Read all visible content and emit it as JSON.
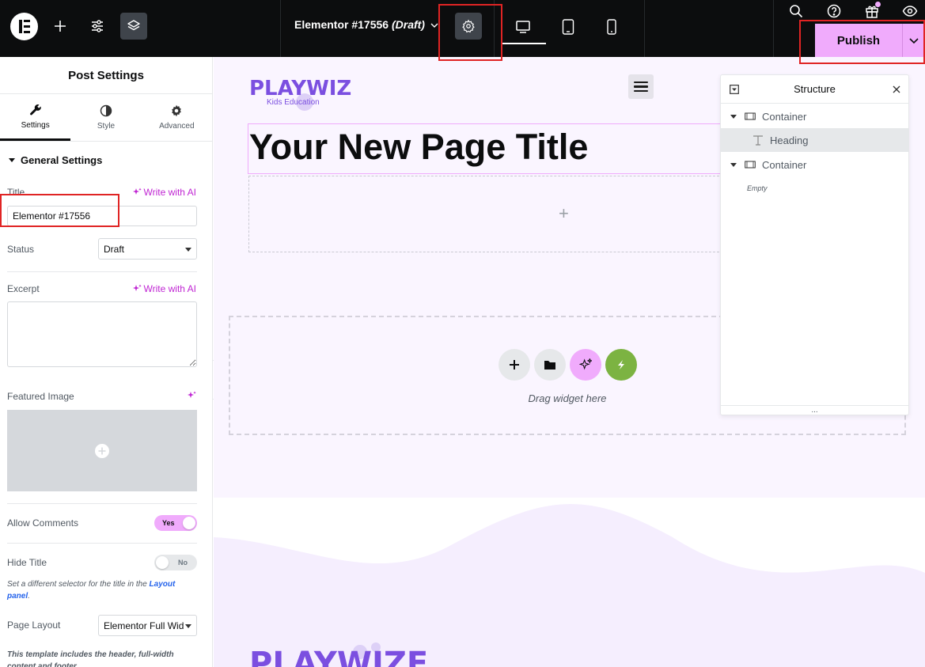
{
  "topbar": {
    "document_name": "Elementor #17556",
    "document_status": "(Draft)",
    "publish_label": "Publish"
  },
  "panel": {
    "title": "Post Settings",
    "tabs": [
      {
        "label": "Settings",
        "icon": "wrench-icon"
      },
      {
        "label": "Style",
        "icon": "half-circle-icon"
      },
      {
        "label": "Advanced",
        "icon": "gear-icon"
      }
    ],
    "section_title": "General Settings",
    "title_label": "Title",
    "write_with_ai": "Write with AI",
    "title_value": "Elementor #17556",
    "status_label": "Status",
    "status_value": "Draft",
    "excerpt_label": "Excerpt",
    "excerpt_value": "",
    "featured_image_label": "Featured Image",
    "allow_comments_label": "Allow Comments",
    "allow_comments_value": "Yes",
    "hide_title_label": "Hide Title",
    "hide_title_value": "No",
    "hide_title_note": "Set a different selector for the title in the",
    "hide_title_note_link": "Layout panel",
    "page_layout_label": "Page Layout",
    "page_layout_value": "Elementor Full Wid",
    "page_layout_note": "This template includes the header, full-width content and footer"
  },
  "canvas": {
    "logo_text": "PLAYWIZE",
    "logo_tagline": "Kids Education",
    "heading": "Your New Page Title",
    "drag_text": "Drag widget here",
    "footer_logo_text": "PLAYWIZE"
  },
  "structure": {
    "title": "Structure",
    "items": [
      {
        "label": "Container",
        "type": "container"
      },
      {
        "label": "Heading",
        "type": "heading"
      },
      {
        "label": "Container",
        "type": "container"
      },
      {
        "label": "Empty",
        "type": "empty"
      }
    ]
  },
  "colors": {
    "accent": "#f0abfc",
    "ai_purple": "#c026d3",
    "brand_purple": "#7b4fe0",
    "annotation_red": "#e02424",
    "green": "#7cb342"
  }
}
